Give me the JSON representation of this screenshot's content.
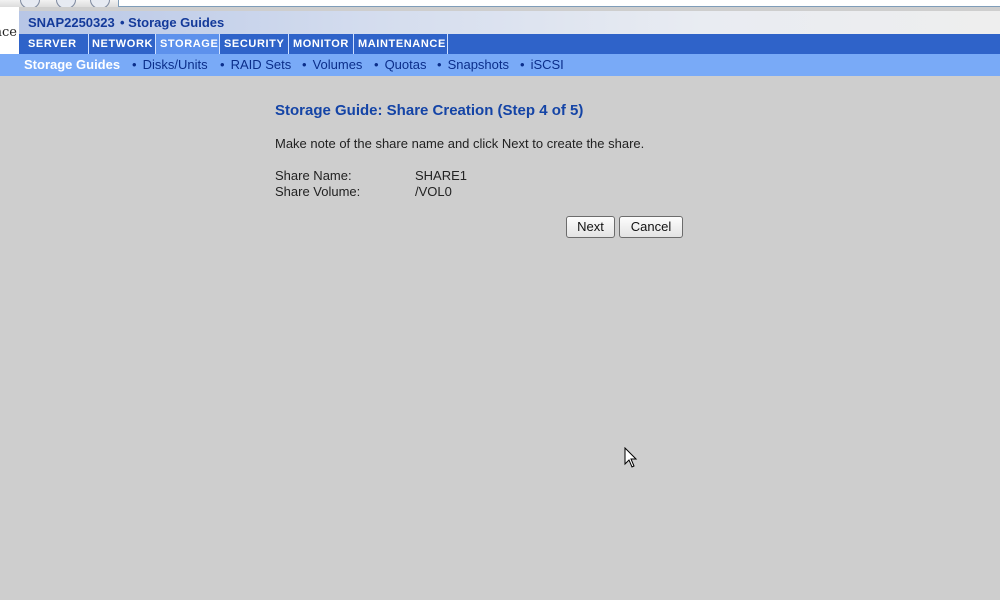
{
  "header": {
    "brand_partial": "nce",
    "host_name": "SNAP2250323",
    "page_title": "• Storage Guides"
  },
  "main_nav": {
    "tabs": [
      {
        "label": "SERVER"
      },
      {
        "label": "NETWORK"
      },
      {
        "label": "STORAGE",
        "active": true
      },
      {
        "label": "SECURITY"
      },
      {
        "label": "MONITOR"
      },
      {
        "label": "MAINTENANCE"
      }
    ]
  },
  "sub_nav": {
    "items": [
      {
        "label": "Storage Guides",
        "active": true
      },
      {
        "label": "Disks/Units"
      },
      {
        "label": "RAID Sets"
      },
      {
        "label": "Volumes"
      },
      {
        "label": "Quotas"
      },
      {
        "label": "Snapshots"
      },
      {
        "label": "iSCSI"
      }
    ],
    "separator": "•"
  },
  "content": {
    "title": "Storage Guide: Share Creation (Step 4 of 5)",
    "instructions": "Make note of the share name and click Next to create the share.",
    "fields": [
      {
        "label": "Share Name:",
        "value": "SHARE1"
      },
      {
        "label": "Share Volume:",
        "value": "/VOL0"
      }
    ],
    "next_label": "Next",
    "cancel_label": "Cancel"
  },
  "colors": {
    "nav_bar": "#2f63c9",
    "nav_active": "#5d91ec",
    "sub_nav": "#79aaf7",
    "page_bg": "#cecece",
    "title_text": "#1444a6"
  },
  "icons": [
    "mouse-cursor-icon",
    "browser-back-icon",
    "browser-stop-icon"
  ]
}
